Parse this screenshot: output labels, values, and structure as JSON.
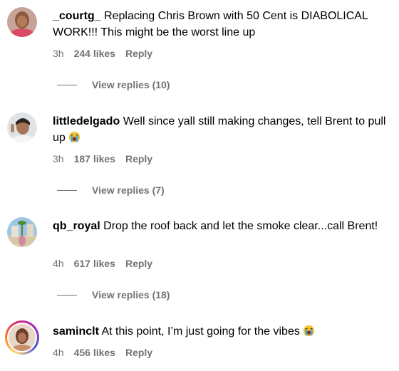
{
  "comments": [
    {
      "username": "_courtg_",
      "text": "Replacing Chris Brown with 50 Cent is DIABOLICAL WORK!!! This might be the worst line up",
      "time": "3h",
      "likes": "244 likes",
      "reply": "Reply",
      "view_replies": "View replies (10)",
      "avatar_icon": "avatar-photo-icon"
    },
    {
      "username": "littledelgado",
      "text": "Well since yall still making changes, tell Brent to pull up",
      "emoji": "loudly-crying-face-icon",
      "time": "3h",
      "likes": "187 likes",
      "reply": "Reply",
      "view_replies": "View replies (7)",
      "avatar_icon": "avatar-photo-icon"
    },
    {
      "username": "qb_royal",
      "text": "Drop the roof back and let the smoke clear...call Brent!",
      "time": "4h",
      "likes": "617 likes",
      "reply": "Reply",
      "view_replies": "View replies (18)",
      "avatar_icon": "avatar-photo-icon"
    },
    {
      "username": "saminclt",
      "text": "At this point, I’m just going for the vibes",
      "emoji": "loudly-crying-face-icon",
      "time": "4h",
      "likes": "456 likes",
      "reply": "Reply",
      "avatar_icon": "avatar-photo-icon",
      "story_ring": true
    }
  ],
  "colors": {
    "text": "#000000",
    "meta": "#737373",
    "emoji_face": "#f7c531",
    "emoji_tears": "#4aa3e8"
  }
}
